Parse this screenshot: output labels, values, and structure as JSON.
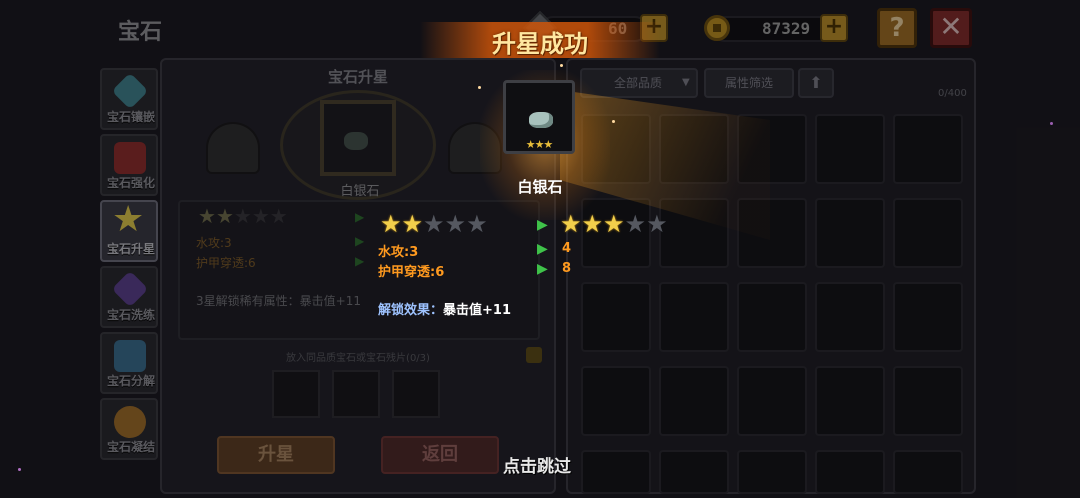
{
  "header": {
    "title": "宝石",
    "gem_currency": "60",
    "gold": "87329",
    "help_label": "?",
    "close_label": "✕"
  },
  "side_tabs": [
    {
      "label": "宝石镶嵌",
      "icon": "gem-inlay-icon",
      "color": "#3f7f8a"
    },
    {
      "label": "宝石强化",
      "icon": "gem-enhance-icon",
      "color": "#8a2d2d"
    },
    {
      "label": "宝石升星",
      "icon": "star-upgrade-icon",
      "color": "#c9b23a"
    },
    {
      "label": "宝石洗练",
      "icon": "gem-refine-icon",
      "color": "#5a3f8a"
    },
    {
      "label": "宝石分解",
      "icon": "gem-decompose-icon",
      "color": "#3a6a8a"
    },
    {
      "label": "宝石凝结",
      "icon": "gem-condense-icon",
      "color": "#9a6a2a"
    }
  ],
  "left_panel": {
    "title": "宝石升星",
    "slot_gem_name": "白银石",
    "current_stats": [
      {
        "label": "水攻:3"
      },
      {
        "label": "护甲穿透:6"
      }
    ],
    "unlock_note": "3星解锁稀有属性：暴击值+11",
    "material_hint": "放入同品质宝石或宝石残片(0/3)",
    "upgrade_button": "升星",
    "back_button": "返回"
  },
  "right_panel": {
    "quality_filter": "全部品质",
    "attribute_filter": "属性筛选",
    "count": "0/400"
  },
  "popup": {
    "title": "升星成功",
    "gem_name": "白银石",
    "card_stars": "★★★",
    "old_stars": 2,
    "new_stars": 3,
    "max_stars": 5,
    "stats": [
      {
        "label": "水攻:3",
        "new_value": "4"
      },
      {
        "label": "护甲穿透:6",
        "new_value": "8"
      }
    ],
    "unlock_label": "解锁效果：",
    "unlock_value": "暴击值+11",
    "skip_text": "点击跳过"
  },
  "colors": {
    "accent_orange": "#ff9a1f",
    "star_gold": "#f2cf4b",
    "arrow_green": "#3fc24a",
    "unlock_blue": "#9ec3ff"
  }
}
